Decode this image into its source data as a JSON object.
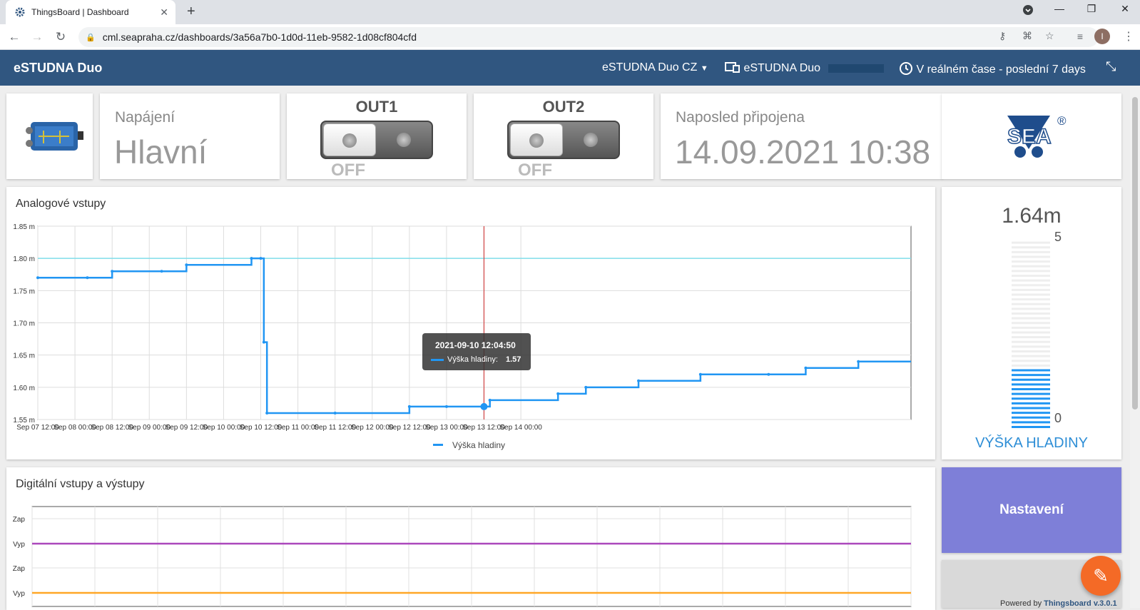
{
  "browser": {
    "tab_title": "ThingsBoard | Dashboard",
    "tab_close": "✕",
    "new_tab": "+",
    "url": "cml.seapraha.cz/dashboards/3a56a7b0-1d0d-11eb-9582-1d08cf804cfd",
    "profile_initial": "I"
  },
  "header": {
    "title": "eSTUDNA Duo",
    "language_select": "eSTUDNA Duo CZ",
    "device_select": "eSTUDNA Duo",
    "timewindow": "V reálném čase - poslední 7 days"
  },
  "power_card": {
    "label": "Napájení",
    "value": "Hlavní"
  },
  "out1": {
    "title": "OUT1",
    "state": "OFF"
  },
  "out2": {
    "title": "OUT2",
    "state": "OFF"
  },
  "last_connected": {
    "label": "Naposled připojena",
    "value": "14.09.2021 10:38"
  },
  "logo": {
    "text": "SEA",
    "registered": "®"
  },
  "analog_chart": {
    "title": "Analogové vstupy",
    "legend": "Výška hladiny",
    "tooltip_time": "2021-09-10 12:04:50",
    "tooltip_series": "Výška hladiny:",
    "tooltip_value": "1.57"
  },
  "level_gauge": {
    "value": "1.64m",
    "max_label": "5",
    "min_label": "0",
    "title": "VÝŠKA HLADINY",
    "value_num": 1.64,
    "max_num": 5
  },
  "digital_chart": {
    "title": "Digitální vstupy a výstupy",
    "y_labels": [
      "Zap",
      "Vyp",
      "Zap",
      "Vyp"
    ]
  },
  "settings_button": {
    "label": "Nastavení"
  },
  "footer": {
    "powered": "Powered by",
    "version": "Thingsboard v.3.0.1"
  },
  "colors": {
    "header": "#305680",
    "series": "#2196f3",
    "threshold": "#80deea",
    "purple": "#ab47bc",
    "orange": "#ffa726",
    "settings": "#7e7fd8",
    "fab": "#f46a26"
  },
  "chart_data": [
    {
      "type": "line",
      "title": "Analogové vstupy",
      "ylabel": "",
      "xlabel": "",
      "ylim": [
        1.55,
        1.85
      ],
      "y_ticks": [
        "1.55 m",
        "1.60 m",
        "1.65 m",
        "1.70 m",
        "1.75 m",
        "1.80 m",
        "1.85 m"
      ],
      "x_ticks": [
        "Sep 07 12:00",
        "Sep 08 00:00",
        "Sep 08 12:00",
        "Sep 09 00:00",
        "Sep 09 12:00",
        "Sep 10 00:00",
        "Sep 10 12:00",
        "Sep 11 00:00",
        "Sep 11 12:00",
        "Sep 12 00:00",
        "Sep 12 12:00",
        "Sep 13 00:00",
        "Sep 13 12:00",
        "Sep 14 00:00"
      ],
      "series": [
        {
          "name": "Výška hladiny",
          "x_hours": [
            0,
            16,
            24,
            40,
            48,
            69,
            72,
            73,
            74,
            96,
            120,
            132,
            146,
            168,
            177,
            194,
            214,
            236,
            248,
            265
          ],
          "values": [
            1.77,
            1.77,
            1.78,
            1.78,
            1.79,
            1.8,
            1.8,
            1.67,
            1.56,
            1.56,
            1.57,
            1.57,
            1.58,
            1.59,
            1.6,
            1.61,
            1.62,
            1.62,
            1.63,
            1.64
          ]
        }
      ],
      "threshold": 1.8,
      "grid": true,
      "legend_position": "bottom"
    }
  ]
}
